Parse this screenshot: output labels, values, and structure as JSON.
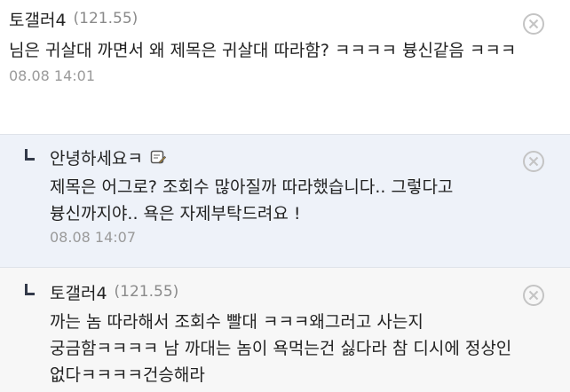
{
  "comments": [
    {
      "nickname": "토갤러4",
      "ip": "(121.55)",
      "body": "님은 귀살대 까면서 왜 제목은 귀살대 따라함? ㅋㅋㅋㅋ 븅신같음 ㅋㅋㅋ",
      "date": "08.08 14:01",
      "delete_icon": "circle-x-icon"
    },
    {
      "nickname": "안녕하세요ㅋ",
      "ip": "",
      "body": "제목은 어그로? 조회수 많아질까 따라했습니다.. 그렇다고 븅신까지야.. 욕은 자제부탁드려요 !",
      "date": "08.08 14:07",
      "reply_icon": "reply-arrow-icon",
      "badge_icon": "memo-edit-icon",
      "delete_icon": "circle-x-icon"
    },
    {
      "nickname": "토갤러4",
      "ip": "(121.55)",
      "body": "까는 놈 따라해서 조회수 빨대 ㅋㅋㅋ왜그러고 사는지 궁금함ㅋㅋㅋㅋ 남 까대는 놈이 욕먹는건 싫다라 참 디시에 정상인 없다ㅋㅋㅋㅋ건승해라",
      "date": "",
      "reply_icon": "reply-arrow-icon",
      "delete_icon": "circle-x-icon"
    }
  ],
  "colors": {
    "reply_background": "#eef2f9",
    "muted_text": "#8a8a8a",
    "icon_gray": "#c4c4c4"
  }
}
